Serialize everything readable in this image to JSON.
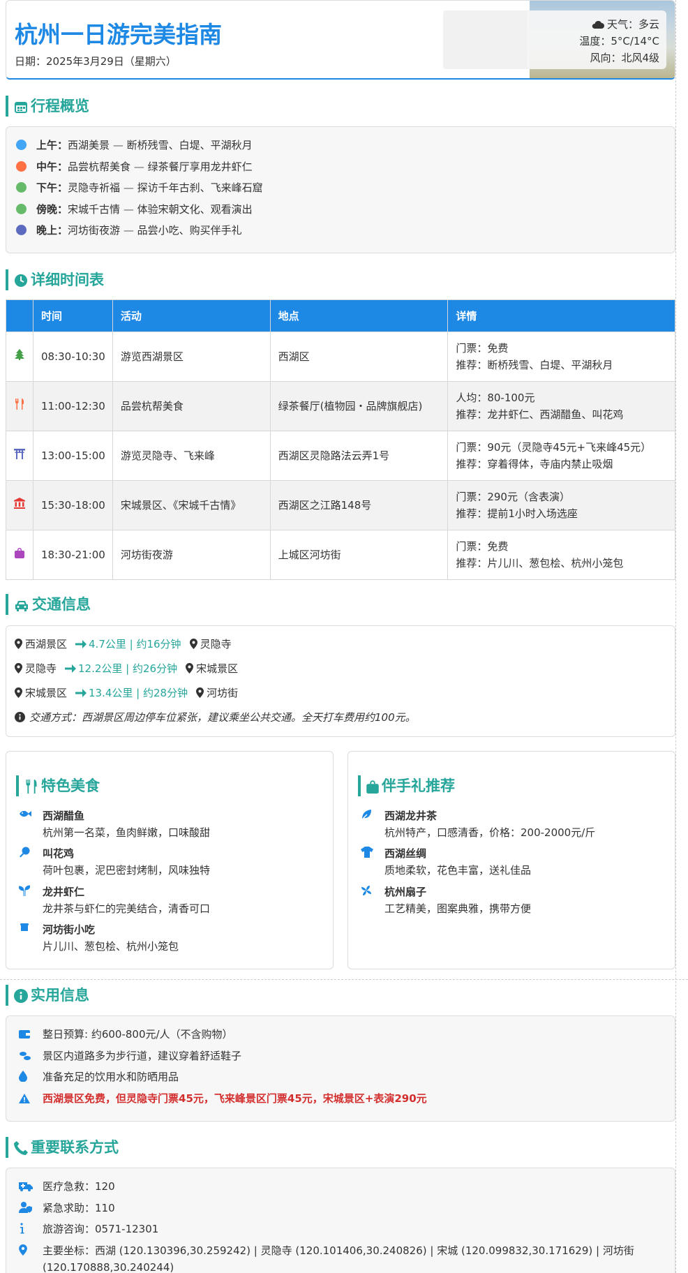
{
  "header": {
    "title": "杭州一日游完美指南",
    "date": "日期：2025年3月29日（星期六）",
    "weather": "天气：多云",
    "temp": "温度：5°C/14°C",
    "wind": "风向：北风4级"
  },
  "overview": {
    "title": "行程概览",
    "items": [
      {
        "label": "上午：",
        "place": "西湖美景",
        "desc": "断桥残雪、白堤、平湖秋月",
        "color": "#42a5f5"
      },
      {
        "label": "中午：",
        "place": "品尝杭帮美食",
        "desc": "绿茶餐厅享用龙井虾仁",
        "color": "#ff7043"
      },
      {
        "label": "下午：",
        "place": "灵隐寺祈福",
        "desc": "探访千年古刹、飞来峰石窟",
        "color": "#66bb6a"
      },
      {
        "label": "傍晚：",
        "place": "宋城千古情",
        "desc": "体验宋朝文化、观看演出",
        "color": "#66bb6a"
      },
      {
        "label": "晚上：",
        "place": "河坊街夜游",
        "desc": "品尝小吃、购买伴手礼",
        "color": "#5c6bc0"
      }
    ],
    "sep": "—"
  },
  "schedule": {
    "title": "详细时间表",
    "headers": [
      "",
      "时间",
      "活动",
      "地点",
      "详情"
    ],
    "rows": [
      {
        "icon": "tree-icon",
        "color": "#43a047",
        "time": "08:30-10:30",
        "activity": "游览西湖景区",
        "place": "西湖区",
        "d1": "门票：免费",
        "d2": "推荐：断桥残雪、白堤、平湖秋月"
      },
      {
        "icon": "utensils-icon",
        "color": "#ff7043",
        "time": "11:00-12:30",
        "activity": "品尝杭帮美食",
        "place": "绿茶餐厅(植物园・品牌旗舰店)",
        "d1": "人均：80-100元",
        "d2": "推荐：龙井虾仁、西湖醋鱼、叫花鸡"
      },
      {
        "icon": "torii-icon",
        "color": "#5c6bc0",
        "time": "13:00-15:00",
        "activity": "游览灵隐寺、飞来峰",
        "place": "西湖区灵隐路法云弄1号",
        "d1": "门票：90元（灵隐寺45元+飞来峰45元）",
        "d2": "推荐：穿着得体，寺庙内禁止吸烟"
      },
      {
        "icon": "landmark-icon",
        "color": "#e53935",
        "time": "15:30-18:00",
        "activity": "宋城景区、《宋城千古情》",
        "place": "西湖区之江路148号",
        "d1": "门票：290元（含表演）",
        "d2": "推荐：提前1小时入场选座"
      },
      {
        "icon": "bag-icon",
        "color": "#ab47bc",
        "time": "18:30-21:00",
        "activity": "河坊街夜游",
        "place": "上城区河坊街",
        "d1": "门票：免费",
        "d2": "推荐：片儿川、葱包桧、杭州小笼包"
      }
    ]
  },
  "transport": {
    "title": "交通信息",
    "routes": [
      {
        "from": "西湖景区",
        "dist": "4.7公里 | 约16分钟",
        "to": "灵隐寺"
      },
      {
        "from": "灵隐寺",
        "dist": "12.2公里 | 约26分钟",
        "to": "宋城景区"
      },
      {
        "from": "宋城景区",
        "dist": "13.4公里 | 约28分钟",
        "to": "河坊街"
      }
    ],
    "note": "交通方式：西湖景区周边停车位紧张，建议乘坐公共交通。全天打车费用约100元。"
  },
  "food": {
    "title": "特色美食",
    "items": [
      {
        "icon": "fish-icon",
        "name": "西湖醋鱼",
        "desc": "杭州第一名菜，鱼肉鲜嫩，口味酸甜"
      },
      {
        "icon": "drumstick-icon",
        "name": "叫花鸡",
        "desc": "荷叶包裹，泥巴密封烤制，风味独特"
      },
      {
        "icon": "seedling-icon",
        "name": "龙井虾仁",
        "desc": "龙井茶与虾仁的完美结合，清香可口"
      },
      {
        "icon": "bowl-icon",
        "name": "河坊街小吃",
        "desc": "片儿川、葱包桧、杭州小笼包"
      }
    ]
  },
  "gifts": {
    "title": "伴手礼推荐",
    "items": [
      {
        "icon": "leaf-icon",
        "name": "西湖龙井茶",
        "desc": "杭州特产，口感清香，价格：200-2000元/斤"
      },
      {
        "icon": "shirt-icon",
        "name": "西湖丝绸",
        "desc": "质地柔软，花色丰富，送礼佳品"
      },
      {
        "icon": "fan-icon",
        "name": "杭州扇子",
        "desc": "工艺精美，图案典雅，携带方便"
      }
    ]
  },
  "practical": {
    "title": "实用信息",
    "items": [
      {
        "icon": "wallet-icon",
        "text": "整日预算: 约600-800元/人（不含购物）"
      },
      {
        "icon": "shoe-icon",
        "text": "景区内道路多为步行道，建议穿着舒适鞋子"
      },
      {
        "icon": "water-drop-icon",
        "text": "准备充足的饮用水和防晒用品"
      },
      {
        "icon": "warning-icon",
        "text": "西湖景区免费，但灵隐寺门票45元，飞来峰景区门票45元，宋城景区+表演290元"
      }
    ]
  },
  "contact": {
    "title": "重要联系方式",
    "items": [
      {
        "icon": "ambulance-icon",
        "text": "医疗急救：120"
      },
      {
        "icon": "police-icon",
        "text": "紧急求助：110"
      },
      {
        "icon": "info-icon",
        "text": "旅游咨询：0571-12301"
      }
    ],
    "coords1": "主要坐标：西湖 (120.130396,30.259242) | 灵隐寺 (120.101406,30.240826) | 宋城 (120.099832,30.171629) | 河坊街",
    "coords2": "(120.170888,30.240244)"
  }
}
